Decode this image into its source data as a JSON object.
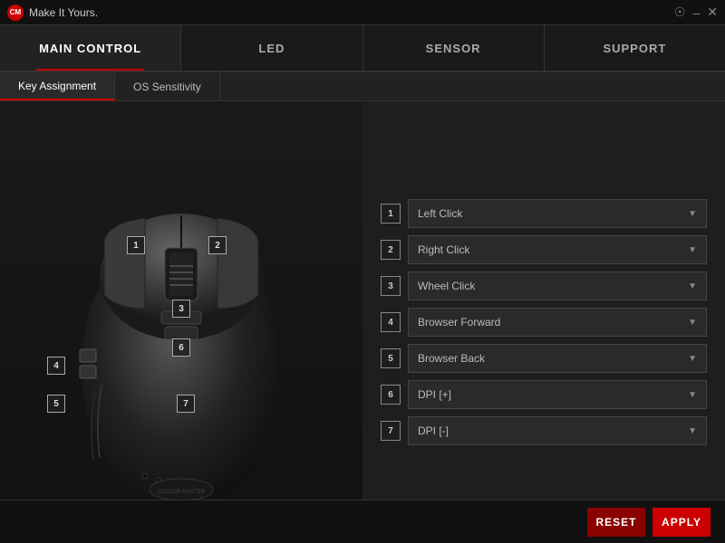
{
  "titlebar": {
    "title": "Make It Yours.",
    "controls": [
      "globe",
      "minimize",
      "close"
    ]
  },
  "nav": {
    "tabs": [
      {
        "id": "main-control",
        "label": "MAIN CONTROL",
        "active": true
      },
      {
        "id": "led",
        "label": "LED",
        "active": false
      },
      {
        "id": "sensor",
        "label": "SENSOR",
        "active": false
      },
      {
        "id": "support",
        "label": "SUPPORT",
        "active": false
      }
    ]
  },
  "subtabs": [
    {
      "id": "key-assignment",
      "label": "Key Assignment",
      "active": true
    },
    {
      "id": "os-sensitivity",
      "label": "OS Sensitivity",
      "active": false
    }
  ],
  "buttons": {
    "labels": [
      {
        "num": "1",
        "class": "btn-label-1"
      },
      {
        "num": "2",
        "class": "btn-label-2"
      },
      {
        "num": "3",
        "class": "btn-label-3"
      },
      {
        "num": "6",
        "class": "btn-label-6"
      },
      {
        "num": "4",
        "class": "btn-label-4"
      },
      {
        "num": "5",
        "class": "btn-label-5"
      },
      {
        "num": "7",
        "class": "btn-label-7"
      }
    ]
  },
  "assignments": [
    {
      "num": "1",
      "label": "Left Click"
    },
    {
      "num": "2",
      "label": "Right Click"
    },
    {
      "num": "3",
      "label": "Wheel Click"
    },
    {
      "num": "4",
      "label": "Browser Forward"
    },
    {
      "num": "5",
      "label": "Browser Back"
    },
    {
      "num": "6",
      "label": "DPI [+]"
    },
    {
      "num": "7",
      "label": "DPI [-]"
    }
  ],
  "footer": {
    "reset_label": "RESET",
    "apply_label": "APPLY"
  }
}
